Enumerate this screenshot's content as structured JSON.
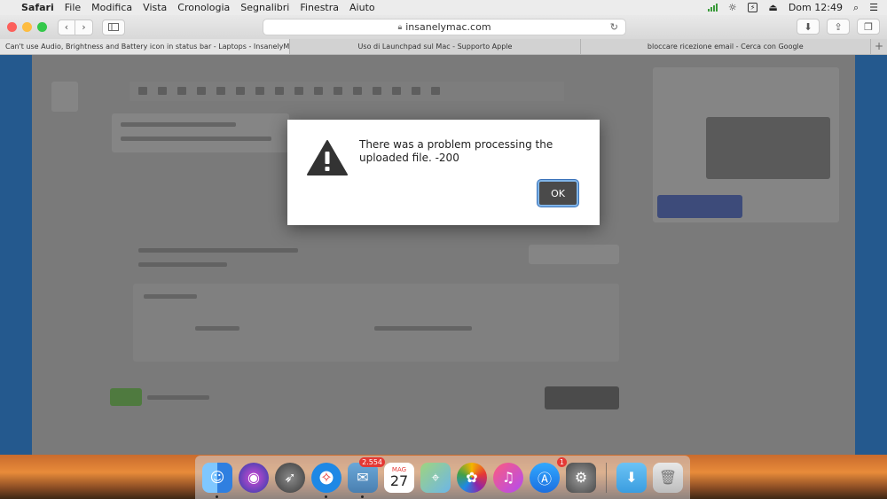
{
  "menubar": {
    "app_name": "Safari",
    "items": [
      "File",
      "Modifica",
      "Vista",
      "Cronologia",
      "Segnalibri",
      "Finestra",
      "Aiuto"
    ],
    "battery": "⚡",
    "clock": "Dom 12:49"
  },
  "toolbar": {
    "url": "insanelymac.com"
  },
  "tabs": [
    {
      "label": "Can't use Audio, Brightness and Battery icon in status bar - Laptops - InsanelyM..."
    },
    {
      "label": "Uso di Launchpad sul Mac - Supporto Apple"
    },
    {
      "label": "bloccare ricezione email - Cerca con Google"
    }
  ],
  "dialog": {
    "message": "There was a problem processing the uploaded file. -200",
    "ok_label": "OK"
  },
  "dock": {
    "mail_badge": "2.554",
    "calendar_month": "MAG",
    "calendar_day": "27",
    "appstore_badge": "1"
  },
  "colors": {
    "menubar": "#ececec",
    "page_blue": "#24598e",
    "ok_button": "#4a4a4a",
    "focus_ring": "#7fb4e8"
  }
}
